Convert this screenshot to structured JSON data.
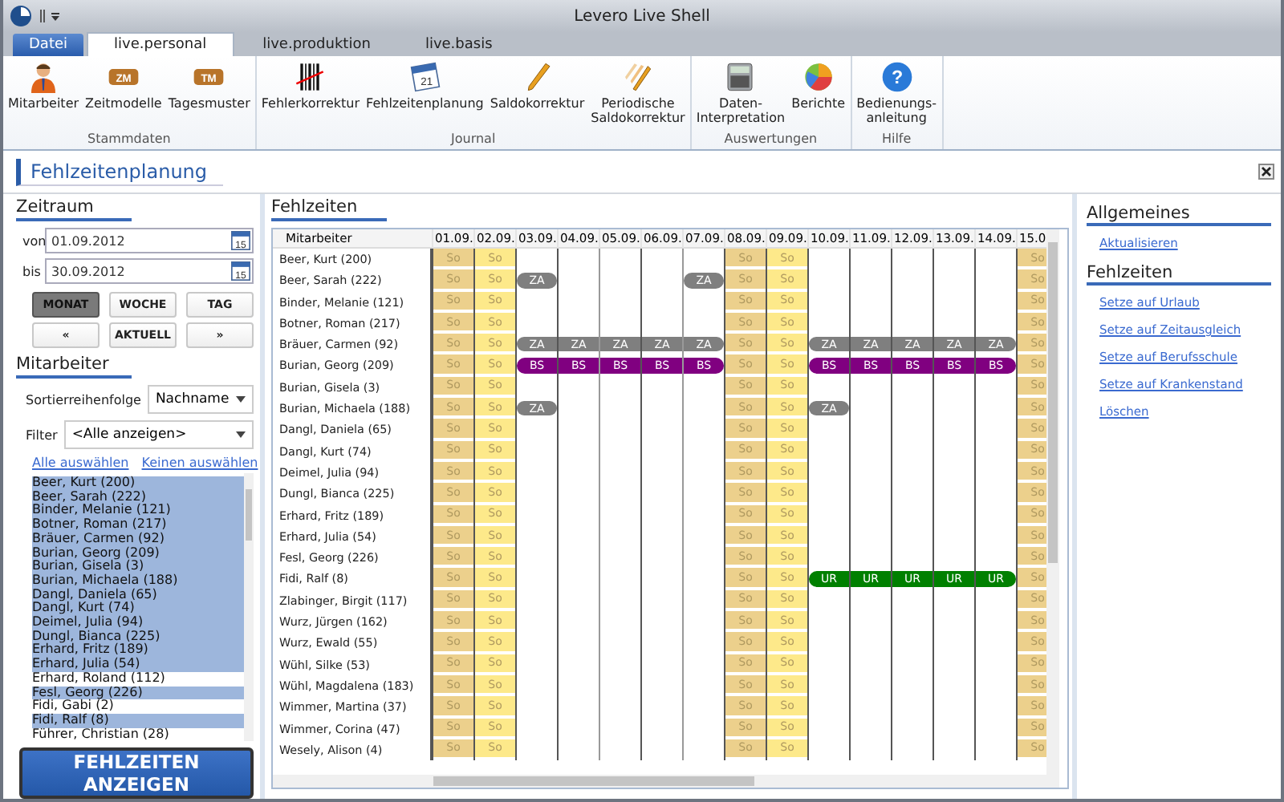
{
  "window": {
    "title": "Levero Live Shell"
  },
  "tabs": [
    {
      "label": "Datei",
      "kind": "file",
      "selected": false
    },
    {
      "label": "live.personal",
      "kind": "tab",
      "selected": true
    },
    {
      "label": "live.produktion",
      "kind": "tab",
      "selected": false
    },
    {
      "label": "live.basis",
      "kind": "tab",
      "selected": false
    }
  ],
  "ribbon": [
    {
      "label": "Stammdaten",
      "items": [
        {
          "label": "Mitarbeiter",
          "kind": "person"
        },
        {
          "label": "Zeitmodelle",
          "kind": "badge",
          "badge": "ZM"
        },
        {
          "label": "Tagesmuster",
          "kind": "badge",
          "badge": "TM"
        }
      ]
    },
    {
      "label": "Journal",
      "items": [
        {
          "label": "Fehlerkorrektur",
          "kind": "barcode"
        },
        {
          "label": "Fehlzeitenplanung",
          "kind": "calendar",
          "badge": "21"
        },
        {
          "label": "Saldokorrektur",
          "kind": "pencil"
        },
        {
          "label": "Periodische\nSaldokorrektur",
          "kind": "pencils"
        }
      ]
    },
    {
      "label": "Auswertungen",
      "items": [
        {
          "label": "Daten-\nInterpretation",
          "kind": "calculator"
        },
        {
          "label": "Berichte",
          "kind": "pie"
        }
      ]
    },
    {
      "label": "Hilfe",
      "items": [
        {
          "label": "Bedienungs-\nanleitung",
          "kind": "help",
          "badge": "?"
        }
      ]
    }
  ],
  "page_title": "Fehlzeitenplanung",
  "left": {
    "period_heading": "Zeitraum",
    "dates": [
      {
        "label": "von",
        "value": "01.09.2012",
        "icon_text": "15"
      },
      {
        "label": "bis",
        "value": "30.09.2012",
        "icon_text": "15"
      }
    ],
    "period_buttons": [
      {
        "label": "MONAT",
        "selected": true
      },
      {
        "label": "WOCHE",
        "selected": false
      },
      {
        "label": "TAG",
        "selected": false
      }
    ],
    "nav_buttons": [
      "«",
      "AKTUELL",
      "»"
    ],
    "staff_heading": "Mitarbeiter",
    "sort": {
      "label": "Sortierreihenfolge",
      "value": "Nachname"
    },
    "filter": {
      "label": "Filter",
      "value": "<Alle anzeigen>"
    },
    "links": [
      "Alle auswählen",
      "Keinen auswählen"
    ],
    "list": [
      {
        "name": "Beer, Kurt (200)",
        "selected": true
      },
      {
        "name": "Beer, Sarah (222)",
        "selected": true
      },
      {
        "name": "Binder, Melanie (121)",
        "selected": true
      },
      {
        "name": "Botner, Roman (217)",
        "selected": true
      },
      {
        "name": "Bräuer, Carmen (92)",
        "selected": true
      },
      {
        "name": "Burian, Georg (209)",
        "selected": true
      },
      {
        "name": "Burian, Gisela (3)",
        "selected": true
      },
      {
        "name": "Burian, Michaela (188)",
        "selected": true
      },
      {
        "name": "Dangl, Daniela (65)",
        "selected": true
      },
      {
        "name": "Dangl, Kurt (74)",
        "selected": true
      },
      {
        "name": "Deimel, Julia (94)",
        "selected": true
      },
      {
        "name": "Dungl, Bianca (225)",
        "selected": true
      },
      {
        "name": "Erhard, Fritz (189)",
        "selected": true
      },
      {
        "name": "Erhard, Julia (54)",
        "selected": true
      },
      {
        "name": "Erhard, Roland (112)",
        "selected": false
      },
      {
        "name": "Fesl, Georg (226)",
        "selected": true
      },
      {
        "name": "Fidi, Gabi (2)",
        "selected": false
      },
      {
        "name": "Fidi, Ralf (8)",
        "selected": true
      },
      {
        "name": "Führer, Christian (28)",
        "selected": false
      }
    ],
    "show_button": "FEHLZEITEN ANZEIGEN"
  },
  "grid": {
    "heading": "Fehlzeiten",
    "name_column": "Mitarbeiter",
    "date_columns": [
      "01.09.",
      "02.09.",
      "03.09.",
      "04.09.",
      "05.09.",
      "06.09.",
      "07.09.",
      "08.09.",
      "09.09.",
      "10.09.",
      "11.09.",
      "12.09.",
      "13.09.",
      "14.09.",
      "15.0"
    ],
    "rows": [
      {
        "name": "Beer, Kurt (200)",
        "cells": [
          {
            "kind": "sat",
            "text": "So"
          },
          {
            "kind": "sun",
            "text": "So"
          },
          null,
          null,
          null,
          null,
          null,
          {
            "kind": "sat",
            "text": "So"
          },
          {
            "kind": "sun",
            "text": "So"
          },
          null,
          null,
          null,
          null,
          null,
          {
            "kind": "sat",
            "text": "So"
          }
        ]
      },
      {
        "name": "Beer, Sarah (222)",
        "cells": [
          {
            "kind": "sat",
            "text": "So"
          },
          {
            "kind": "sun",
            "text": "So"
          },
          {
            "kind": "za",
            "text": "ZA"
          },
          null,
          null,
          null,
          {
            "kind": "za",
            "text": "ZA"
          },
          {
            "kind": "sat",
            "text": "So"
          },
          {
            "kind": "sun",
            "text": "So"
          },
          null,
          null,
          null,
          null,
          null,
          {
            "kind": "sat",
            "text": "So"
          }
        ]
      },
      {
        "name": "Binder, Melanie (121)",
        "cells": [
          {
            "kind": "sat",
            "text": "So"
          },
          {
            "kind": "sun",
            "text": "So"
          },
          null,
          null,
          null,
          null,
          null,
          {
            "kind": "sat",
            "text": "So"
          },
          {
            "kind": "sun",
            "text": "So"
          },
          null,
          null,
          null,
          null,
          null,
          {
            "kind": "sat",
            "text": "So"
          }
        ]
      },
      {
        "name": "Botner, Roman (217)",
        "cells": [
          {
            "kind": "sat",
            "text": "So"
          },
          {
            "kind": "sun",
            "text": "So"
          },
          null,
          null,
          null,
          null,
          null,
          {
            "kind": "sat",
            "text": "So"
          },
          {
            "kind": "sun",
            "text": "So"
          },
          null,
          null,
          null,
          null,
          null,
          {
            "kind": "sat",
            "text": "So"
          }
        ]
      },
      {
        "name": "Bräuer, Carmen (92)",
        "cells": [
          {
            "kind": "sat",
            "text": "So"
          },
          {
            "kind": "sun",
            "text": "So"
          },
          {
            "kind": "za",
            "text": "ZA"
          },
          {
            "kind": "za",
            "text": "ZA"
          },
          {
            "kind": "za",
            "text": "ZA"
          },
          {
            "kind": "za",
            "text": "ZA"
          },
          {
            "kind": "za",
            "text": "ZA"
          },
          {
            "kind": "sat",
            "text": "So"
          },
          {
            "kind": "sun",
            "text": "So"
          },
          {
            "kind": "za",
            "text": "ZA"
          },
          {
            "kind": "za",
            "text": "ZA"
          },
          {
            "kind": "za",
            "text": "ZA"
          },
          {
            "kind": "za",
            "text": "ZA"
          },
          {
            "kind": "za",
            "text": "ZA"
          },
          {
            "kind": "sat",
            "text": "So"
          }
        ]
      },
      {
        "name": "Burian, Georg (209)",
        "cells": [
          {
            "kind": "sat",
            "text": "So"
          },
          {
            "kind": "sun",
            "text": "So"
          },
          {
            "kind": "bs",
            "text": "BS"
          },
          {
            "kind": "bs",
            "text": "BS"
          },
          {
            "kind": "bs",
            "text": "BS"
          },
          {
            "kind": "bs",
            "text": "BS"
          },
          {
            "kind": "bs",
            "text": "BS"
          },
          {
            "kind": "sat",
            "text": "So"
          },
          {
            "kind": "sun",
            "text": "So"
          },
          {
            "kind": "bs",
            "text": "BS"
          },
          {
            "kind": "bs",
            "text": "BS"
          },
          {
            "kind": "bs",
            "text": "BS"
          },
          {
            "kind": "bs",
            "text": "BS"
          },
          {
            "kind": "bs",
            "text": "BS"
          },
          {
            "kind": "sat",
            "text": "So"
          }
        ]
      },
      {
        "name": "Burian, Gisela (3)",
        "cells": [
          {
            "kind": "sat",
            "text": "So"
          },
          {
            "kind": "sun",
            "text": "So"
          },
          null,
          null,
          null,
          null,
          null,
          {
            "kind": "sat",
            "text": "So"
          },
          {
            "kind": "sun",
            "text": "So"
          },
          null,
          null,
          null,
          null,
          null,
          {
            "kind": "sat",
            "text": "So"
          }
        ]
      },
      {
        "name": "Burian, Michaela (188)",
        "cells": [
          {
            "kind": "sat",
            "text": "So"
          },
          {
            "kind": "sun",
            "text": "So"
          },
          {
            "kind": "za",
            "text": "ZA"
          },
          null,
          null,
          null,
          null,
          {
            "kind": "sat",
            "text": "So"
          },
          {
            "kind": "sun",
            "text": "So"
          },
          {
            "kind": "za",
            "text": "ZA"
          },
          null,
          null,
          null,
          null,
          {
            "kind": "sat",
            "text": "So"
          }
        ]
      },
      {
        "name": "Dangl, Daniela (65)",
        "cells": [
          {
            "kind": "sat",
            "text": "So"
          },
          {
            "kind": "sun",
            "text": "So"
          },
          null,
          null,
          null,
          null,
          null,
          {
            "kind": "sat",
            "text": "So"
          },
          {
            "kind": "sun",
            "text": "So"
          },
          null,
          null,
          null,
          null,
          null,
          {
            "kind": "sat",
            "text": "So"
          }
        ]
      },
      {
        "name": "Dangl, Kurt (74)",
        "cells": [
          {
            "kind": "sat",
            "text": "So"
          },
          {
            "kind": "sun",
            "text": "So"
          },
          null,
          null,
          null,
          null,
          null,
          {
            "kind": "sat",
            "text": "So"
          },
          {
            "kind": "sun",
            "text": "So"
          },
          null,
          null,
          null,
          null,
          null,
          {
            "kind": "sat",
            "text": "So"
          }
        ]
      },
      {
        "name": "Deimel, Julia (94)",
        "cells": [
          {
            "kind": "sat",
            "text": "So"
          },
          {
            "kind": "sun",
            "text": "So"
          },
          null,
          null,
          null,
          null,
          null,
          {
            "kind": "sat",
            "text": "So"
          },
          {
            "kind": "sun",
            "text": "So"
          },
          null,
          null,
          null,
          null,
          null,
          {
            "kind": "sat",
            "text": "So"
          }
        ]
      },
      {
        "name": "Dungl, Bianca (225)",
        "cells": [
          {
            "kind": "sat",
            "text": "So"
          },
          {
            "kind": "sun",
            "text": "So"
          },
          null,
          null,
          null,
          null,
          null,
          {
            "kind": "sat",
            "text": "So"
          },
          {
            "kind": "sun",
            "text": "So"
          },
          null,
          null,
          null,
          null,
          null,
          {
            "kind": "sat",
            "text": "So"
          }
        ]
      },
      {
        "name": "Erhard, Fritz (189)",
        "cells": [
          {
            "kind": "sat",
            "text": "So"
          },
          {
            "kind": "sun",
            "text": "So"
          },
          null,
          null,
          null,
          null,
          null,
          {
            "kind": "sat",
            "text": "So"
          },
          {
            "kind": "sun",
            "text": "So"
          },
          null,
          null,
          null,
          null,
          null,
          {
            "kind": "sat",
            "text": "So"
          }
        ]
      },
      {
        "name": "Erhard, Julia (54)",
        "cells": [
          {
            "kind": "sat",
            "text": "So"
          },
          {
            "kind": "sun",
            "text": "So"
          },
          null,
          null,
          null,
          null,
          null,
          {
            "kind": "sat",
            "text": "So"
          },
          {
            "kind": "sun",
            "text": "So"
          },
          null,
          null,
          null,
          null,
          null,
          {
            "kind": "sat",
            "text": "So"
          }
        ]
      },
      {
        "name": "Fesl, Georg (226)",
        "cells": [
          {
            "kind": "sat",
            "text": "So"
          },
          {
            "kind": "sun",
            "text": "So"
          },
          null,
          null,
          null,
          null,
          null,
          {
            "kind": "sat",
            "text": "So"
          },
          {
            "kind": "sun",
            "text": "So"
          },
          null,
          null,
          null,
          null,
          null,
          {
            "kind": "sat",
            "text": "So"
          }
        ]
      },
      {
        "name": "Fidi, Ralf (8)",
        "cells": [
          {
            "kind": "sat",
            "text": "So"
          },
          {
            "kind": "sun",
            "text": "So"
          },
          null,
          null,
          null,
          null,
          null,
          {
            "kind": "sat",
            "text": "So"
          },
          {
            "kind": "sun",
            "text": "So"
          },
          {
            "kind": "ur",
            "text": "UR"
          },
          {
            "kind": "ur",
            "text": "UR"
          },
          {
            "kind": "ur",
            "text": "UR"
          },
          {
            "kind": "ur",
            "text": "UR"
          },
          {
            "kind": "ur",
            "text": "UR"
          },
          {
            "kind": "sat",
            "text": "So"
          }
        ]
      },
      {
        "name": "Zlabinger, Birgit (117)",
        "cells": [
          {
            "kind": "sat",
            "text": "So"
          },
          {
            "kind": "sun",
            "text": "So"
          },
          null,
          null,
          null,
          null,
          null,
          {
            "kind": "sat",
            "text": "So"
          },
          {
            "kind": "sun",
            "text": "So"
          },
          null,
          null,
          null,
          null,
          null,
          {
            "kind": "sat",
            "text": "So"
          }
        ]
      },
      {
        "name": "Wurz, Jürgen (162)",
        "cells": [
          {
            "kind": "sat",
            "text": "So"
          },
          {
            "kind": "sun",
            "text": "So"
          },
          null,
          null,
          null,
          null,
          null,
          {
            "kind": "sat",
            "text": "So"
          },
          {
            "kind": "sun",
            "text": "So"
          },
          null,
          null,
          null,
          null,
          null,
          {
            "kind": "sat",
            "text": "So"
          }
        ]
      },
      {
        "name": "Wurz, Ewald (55)",
        "cells": [
          {
            "kind": "sat",
            "text": "So"
          },
          {
            "kind": "sun",
            "text": "So"
          },
          null,
          null,
          null,
          null,
          null,
          {
            "kind": "sat",
            "text": "So"
          },
          {
            "kind": "sun",
            "text": "So"
          },
          null,
          null,
          null,
          null,
          null,
          {
            "kind": "sat",
            "text": "So"
          }
        ]
      },
      {
        "name": "Wühl, Silke (53)",
        "cells": [
          {
            "kind": "sat",
            "text": "So"
          },
          {
            "kind": "sun",
            "text": "So"
          },
          null,
          null,
          null,
          null,
          null,
          {
            "kind": "sat",
            "text": "So"
          },
          {
            "kind": "sun",
            "text": "So"
          },
          null,
          null,
          null,
          null,
          null,
          {
            "kind": "sat",
            "text": "So"
          }
        ]
      },
      {
        "name": "Wühl, Magdalena (183)",
        "cells": [
          {
            "kind": "sat",
            "text": "So"
          },
          {
            "kind": "sun",
            "text": "So"
          },
          null,
          null,
          null,
          null,
          null,
          {
            "kind": "sat",
            "text": "So"
          },
          {
            "kind": "sun",
            "text": "So"
          },
          null,
          null,
          null,
          null,
          null,
          {
            "kind": "sat",
            "text": "So"
          }
        ]
      },
      {
        "name": "Wimmer, Martina (37)",
        "cells": [
          {
            "kind": "sat",
            "text": "So"
          },
          {
            "kind": "sun",
            "text": "So"
          },
          null,
          null,
          null,
          null,
          null,
          {
            "kind": "sat",
            "text": "So"
          },
          {
            "kind": "sun",
            "text": "So"
          },
          null,
          null,
          null,
          null,
          null,
          {
            "kind": "sat",
            "text": "So"
          }
        ]
      },
      {
        "name": "Wimmer, Corina (47)",
        "cells": [
          {
            "kind": "sat",
            "text": "So"
          },
          {
            "kind": "sun",
            "text": "So"
          },
          null,
          null,
          null,
          null,
          null,
          {
            "kind": "sat",
            "text": "So"
          },
          {
            "kind": "sun",
            "text": "So"
          },
          null,
          null,
          null,
          null,
          null,
          {
            "kind": "sat",
            "text": "So"
          }
        ]
      },
      {
        "name": "Wesely, Alison (4)",
        "cells": [
          {
            "kind": "sat",
            "text": "So"
          },
          {
            "kind": "sun",
            "text": "So"
          },
          null,
          null,
          null,
          null,
          null,
          {
            "kind": "sat",
            "text": "So"
          },
          {
            "kind": "sun",
            "text": "So"
          },
          null,
          null,
          null,
          null,
          null,
          {
            "kind": "sat",
            "text": "So"
          }
        ]
      }
    ]
  },
  "right": [
    {
      "heading": "Allgemeines",
      "links": [
        "Aktualisieren"
      ]
    },
    {
      "heading": "Fehlzeiten",
      "links": [
        "Setze auf Urlaub",
        "Setze auf Zeitausgleich",
        "Setze auf Berufsschule",
        "Setze auf Krankenstand",
        "Löschen"
      ]
    }
  ]
}
